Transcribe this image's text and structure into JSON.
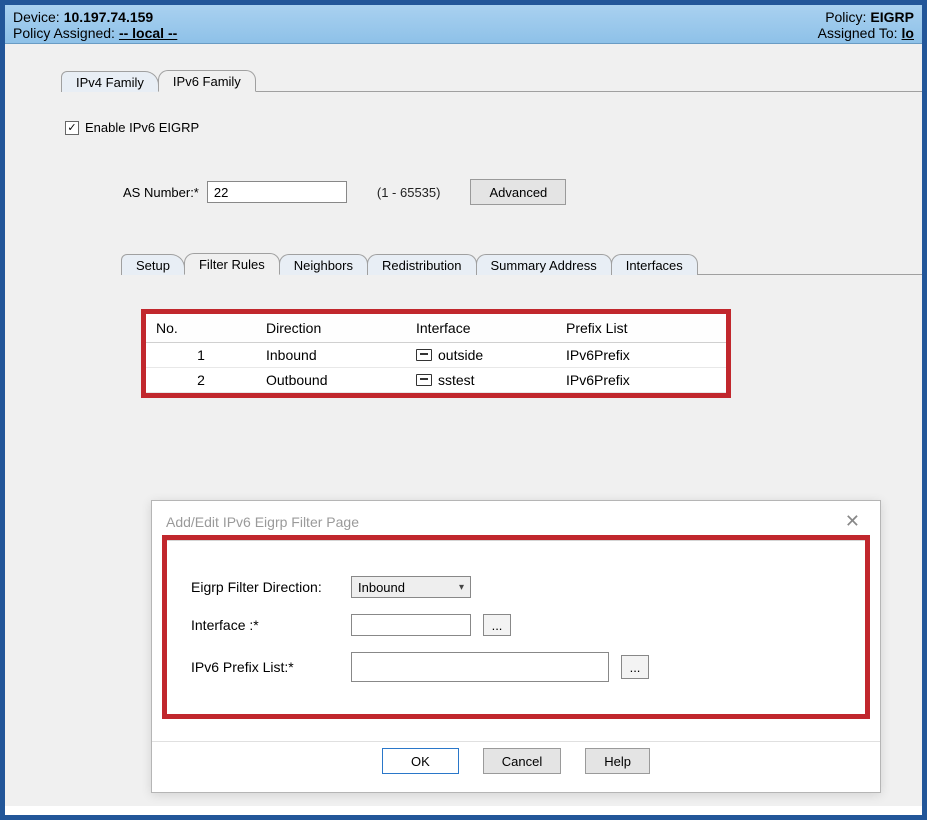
{
  "header": {
    "device_label": "Device:",
    "device_value": "10.197.74.159",
    "policy_assigned_label": "Policy Assigned:",
    "policy_assigned_value": "-- local --",
    "policy_label": "Policy:",
    "policy_value": "EIGRP",
    "assigned_to_label": "Assigned To:",
    "assigned_to_value": "lo"
  },
  "family_tabs": {
    "ipv4": "IPv4 Family",
    "ipv6": "IPv6 Family",
    "active": "ipv6"
  },
  "enable": {
    "checkbox_checked": true,
    "label": "Enable IPv6 EIGRP"
  },
  "as": {
    "label": "AS Number:*",
    "value": "22",
    "range": "(1 - 65535)",
    "advanced": "Advanced"
  },
  "inner_tabs": {
    "items": [
      "Setup",
      "Filter Rules",
      "Neighbors",
      "Redistribution",
      "Summary Address",
      "Interfaces"
    ],
    "active_index": 1
  },
  "table": {
    "headers": {
      "no": "No.",
      "direction": "Direction",
      "interface": "Interface",
      "prefix": "Prefix List"
    },
    "rows": [
      {
        "no": "1",
        "direction": "Inbound",
        "interface": "outside",
        "prefix": "IPv6Prefix"
      },
      {
        "no": "2",
        "direction": "Outbound",
        "interface": "sstest",
        "prefix": "IPv6Prefix"
      }
    ]
  },
  "dialog": {
    "title": "Add/Edit IPv6 Eigrp Filter Page",
    "fields": {
      "direction_label": "Eigrp Filter Direction:",
      "direction_value": "Inbound",
      "interface_label": "Interface :*",
      "interface_value": "",
      "prefix_label": "IPv6 Prefix List:*",
      "prefix_value": ""
    },
    "buttons": {
      "ok": "OK",
      "cancel": "Cancel",
      "help": "Help"
    },
    "browse": "..."
  }
}
